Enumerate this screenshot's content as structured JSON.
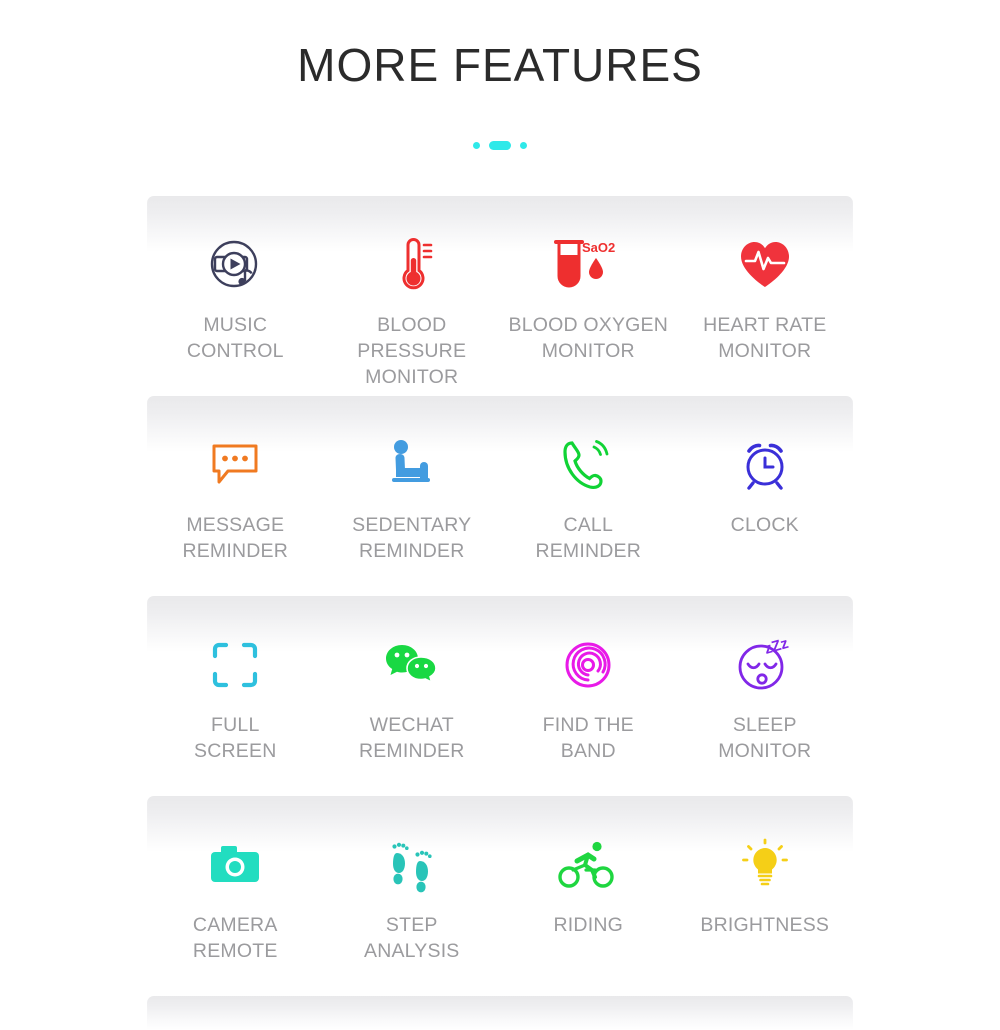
{
  "header": {
    "title": "MORE FEATURES",
    "decorator": {
      "icon": "dot-pill-dot-decorator",
      "color": "#2FE9E9"
    }
  },
  "colors": {
    "title": "#2b2b2b",
    "label": "#9b9b9e",
    "accent_cyan": "#2FE9E9",
    "row_band": "#e9e9eb",
    "background": "#ffffff"
  },
  "rows": [
    {
      "cells": [
        {
          "label": "MUSIC\nCONTROL",
          "icon": "music-disc-icon",
          "color": "#3d3f5c"
        },
        {
          "label": "BLOOD\nPRESSURE\nMONITOR",
          "icon": "thermometer-icon",
          "color": "#ee2f2f"
        },
        {
          "label": "BLOOD OXYGEN\nMONITOR",
          "icon": "test-tube-sao2-icon",
          "color": "#ee2f2f",
          "icon_text": "SaO2"
        },
        {
          "label": "HEART RATE\nMONITOR",
          "icon": "heart-pulse-icon",
          "color": "#f0333c"
        }
      ]
    },
    {
      "cells": [
        {
          "label": "MESSAGE\nREMINDER",
          "icon": "speech-bubble-dots-icon",
          "color": "#f07a21"
        },
        {
          "label": "SEDENTARY\nREMINDER",
          "icon": "seated-person-icon",
          "color": "#439ce0"
        },
        {
          "label": "CALL\nREMINDER",
          "icon": "phone-ringing-icon",
          "color": "#10d335"
        },
        {
          "label": "CLOCK",
          "icon": "alarm-clock-icon",
          "color": "#3a2fd8"
        }
      ]
    },
    {
      "cells": [
        {
          "label": "FULL\nSCREEN",
          "icon": "fullscreen-brackets-icon",
          "color": "#2ec0de"
        },
        {
          "label": "WECHAT\nREMINDER",
          "icon": "wechat-bubbles-icon",
          "color": "#19d843"
        },
        {
          "label": "FIND THE\nBAND",
          "icon": "spiral-rings-icon",
          "color": "#e81ae8"
        },
        {
          "label": "SLEEP\nMONITOR",
          "icon": "sleeping-face-icon",
          "color": "#8127e8",
          "icon_text": "zZz"
        }
      ]
    },
    {
      "cells": [
        {
          "label": "CAMERA\nREMOTE",
          "icon": "camera-icon",
          "color": "#22ddc0"
        },
        {
          "label": "STEP\nANALYSIS",
          "icon": "footprints-icon",
          "color": "#29c4b8"
        },
        {
          "label": "RIDING",
          "icon": "cyclist-icon",
          "color": "#1fd640"
        },
        {
          "label": "BRIGHTNESS",
          "icon": "light-bulb-icon",
          "color": "#f5cf17"
        }
      ]
    }
  ]
}
